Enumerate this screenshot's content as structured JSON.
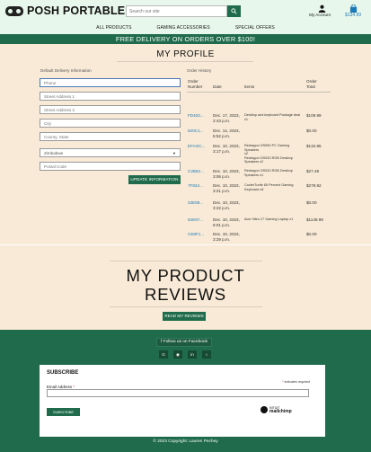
{
  "header": {
    "logo_text": "POSH PORTABLES",
    "search_placeholder": "Search our site",
    "account_label": "My Account",
    "bag_total": "$134.99"
  },
  "nav": [
    "ALL PRODUCTS",
    "GAMING ACCESSORIES",
    "SPECIAL OFFERS"
  ],
  "banner": "FREE DELIVERY ON ORDERS OVER $100!",
  "profile": {
    "title": "MY PROFILE",
    "delivery_label": "Default Delivery Information",
    "fields": [
      {
        "placeholder": "Phone"
      },
      {
        "placeholder": "Street Address 1"
      },
      {
        "placeholder": "Street Address 2"
      },
      {
        "placeholder": "City"
      },
      {
        "placeholder": "County, State"
      },
      {
        "value": "Zimbabwe"
      },
      {
        "placeholder": "Postal Code"
      }
    ],
    "update_button": "UPDATE INFORMATION"
  },
  "history": {
    "label": "Order History",
    "headers": {
      "number_line1": "Order",
      "number_line2": "Number",
      "date": "Date",
      "items": "Items",
      "total_line1": "Order",
      "total_line2": "Total"
    },
    "rows": [
      {
        "num": "FD403...",
        "date1": "Dec. 17, 2023,",
        "date2": "2:43 p.m.",
        "items": [
          "Desktop and keyboard Package deal",
          "x1"
        ],
        "total": "$109.99"
      },
      {
        "num": "820C1...",
        "date1": "Dec. 14, 2023,",
        "date2": "6:52 p.m.",
        "items": [],
        "total": "$0.00"
      },
      {
        "num": "EFAOC...",
        "date1": "Dec. 10, 2023,",
        "date2": "3:17 p.m.",
        "items": [
          "Redragon GS550 PC Gaming Speakers",
          "x2",
          "Redragon GS520 RGB Desktop",
          "Speakers x2"
        ],
        "total": "$134.95"
      },
      {
        "num": "C2B62...",
        "date1": "Dec. 10, 2023,",
        "date2": "3:06 p.m.",
        "items": [
          "Redragon GS520 RGB Desktop",
          "Speakers x1"
        ],
        "total": "$27.49"
      },
      {
        "num": "7F834...",
        "date1": "Dec. 10, 2023,",
        "date2": "3:21 p.m.",
        "items": [
          "CoolerTurtle 65 Percent Gaming",
          "Keyboard x8"
        ],
        "total": "$279.92"
      },
      {
        "num": "23E98...",
        "date1": "Dec. 10, 2023,",
        "date2": "3:22 p.m.",
        "items": [],
        "total": "$0.00"
      },
      {
        "num": "52E97...",
        "date1": "Dec. 10, 2023,",
        "date2": "6:01 p.m.",
        "items": [
          "Acer Nitro 17 Gaming Laptop x1"
        ],
        "total": "$1149.99"
      },
      {
        "num": "CE8F1...",
        "date1": "Dec. 10, 2023,",
        "date2": "3:29 p.m.",
        "items": [],
        "total": "$0.00"
      },
      {
        "num": "31259...",
        "date1": "Dec. 19, 2023,",
        "date2": "9:19 a.m.",
        "items": [
          "Razer Nommo Chroma Custom",
          "Woven 3\" Glass Fiber Drivers x1"
        ],
        "total": "$149.99"
      }
    ]
  },
  "reviews": {
    "title_line1": "MY PRODUCT",
    "title_line2": "REVIEWS",
    "button": "READ MY REVIEWS"
  },
  "footer": {
    "facebook_button": "Follow us on Facebook",
    "subscribe_title": "SUBSCRIBE",
    "required_note": "indicates required",
    "email_label": "Email Address",
    "subscribe_button": "SUBSCRIBE",
    "intuit_label": "INTUIT",
    "mailchimp_label": "mailchimp",
    "copyright": "© 2023 Copyright: Lauren Pechey"
  },
  "colors": {
    "brand_green": "#1f6b4b",
    "header_bg": "#e8f7ec",
    "section_bg": "#f8ead6",
    "link_blue": "#1a7ab8"
  }
}
